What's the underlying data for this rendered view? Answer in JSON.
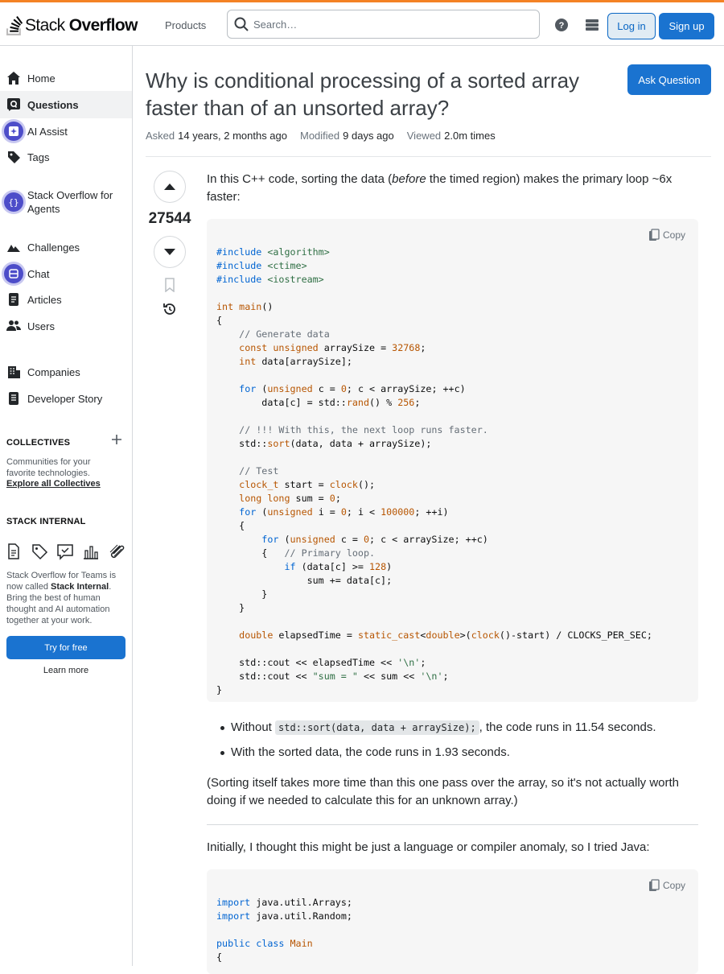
{
  "header": {
    "logo_text_1": "Stack",
    "logo_text_2": " Overflow",
    "products": "Products",
    "search_placeholder": "Search…",
    "login": "Log in",
    "signup": "Sign up"
  },
  "sidebar": {
    "items": [
      {
        "label": "Home",
        "icon": "home-icon"
      },
      {
        "label": "Questions",
        "icon": "questions-icon"
      },
      {
        "label": "AI Assist",
        "icon": "ai-assist-icon"
      },
      {
        "label": "Tags",
        "icon": "tag-icon"
      },
      {
        "label": "Stack Overflow for Agents",
        "icon": "agents-icon"
      },
      {
        "label": "Challenges",
        "icon": "challenges-icon"
      },
      {
        "label": "Chat",
        "icon": "chat-icon"
      },
      {
        "label": "Articles",
        "icon": "articles-icon"
      },
      {
        "label": "Users",
        "icon": "users-icon"
      },
      {
        "label": "Companies",
        "icon": "companies-icon"
      },
      {
        "label": "Developer Story",
        "icon": "developer-story-icon"
      }
    ],
    "collectives_title": "COLLECTIVES",
    "collectives_desc": "Communities for your favorite technologies.",
    "collectives_link": "Explore all Collectives",
    "internal_title": "STACK INTERNAL",
    "internal_desc_1": "Stack Overflow for Teams is now called ",
    "internal_desc_bold": "Stack Internal",
    "internal_desc_2": ". Bring the best of human thought and AI automation together at your work.",
    "try_free": "Try for free",
    "learn_more": "Learn more"
  },
  "question": {
    "title": "Why is conditional processing of a sorted array faster than of an unsorted array?",
    "ask_button": "Ask Question",
    "asked_label": "Asked",
    "asked_value": "14 years, 2 months ago",
    "modified_label": "Modified",
    "modified_value": "9 days ago",
    "viewed_label": "Viewed",
    "viewed_value": "2.0m times",
    "score": "27544",
    "intro_1": "In this C++ code, sorting the data (",
    "intro_em": "before",
    "intro_2": " the timed region) makes the primary loop ~6x faster:",
    "copy_label": "Copy",
    "bullet1_pre": "Without ",
    "bullet1_code": "std::sort(data, data + arraySize);",
    "bullet1_post": ", the code runs in 11.54 seconds.",
    "bullet2": "With the sorted data, the code runs in 1.93 seconds.",
    "para2": "(Sorting itself takes more time than this one pass over the array, so it's not actually worth doing if we needed to calculate this for an unknown array.)",
    "para3": "Initially, I thought this might be just a language or compiler anomaly, so I tried Java:"
  },
  "colors": {
    "accent": "#f48225",
    "primary_button": "#1a73d0",
    "link": "#0a67c4"
  }
}
